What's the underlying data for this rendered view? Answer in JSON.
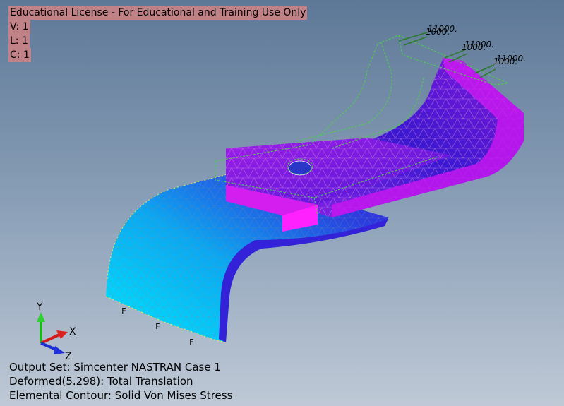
{
  "license": {
    "title": "Educational License - For Educational and Training Use Only",
    "view_label": "V: 1",
    "layer_label": "L: 1",
    "csys_label": "C: 1"
  },
  "status": {
    "output_set": "Output Set: Simcenter NASTRAN Case 1",
    "deformed": "Deformed(5.298): Total Translation",
    "contour": "Elemental Contour: Solid Von Mises Stress"
  },
  "triad": {
    "x": "X",
    "y": "Y",
    "z": "Z"
  },
  "loads": [
    {
      "text": "11000."
    },
    {
      "text": "1000."
    },
    {
      "text": "11000."
    },
    {
      "text": "1000."
    },
    {
      "text": "11000."
    },
    {
      "text": "1000."
    }
  ],
  "constraint_symbol": "F",
  "colors": {
    "contour_low": "#00e6ff",
    "contour_mid": "#1414d2",
    "contour_high": "#ff10ff",
    "undeformed_outline": "#5fd35a",
    "license_bg": "#c08286"
  },
  "icons": {
    "triad": "xyz-triad-icon",
    "constraint": "constraint-icon",
    "load": "force-arrow-icon"
  }
}
